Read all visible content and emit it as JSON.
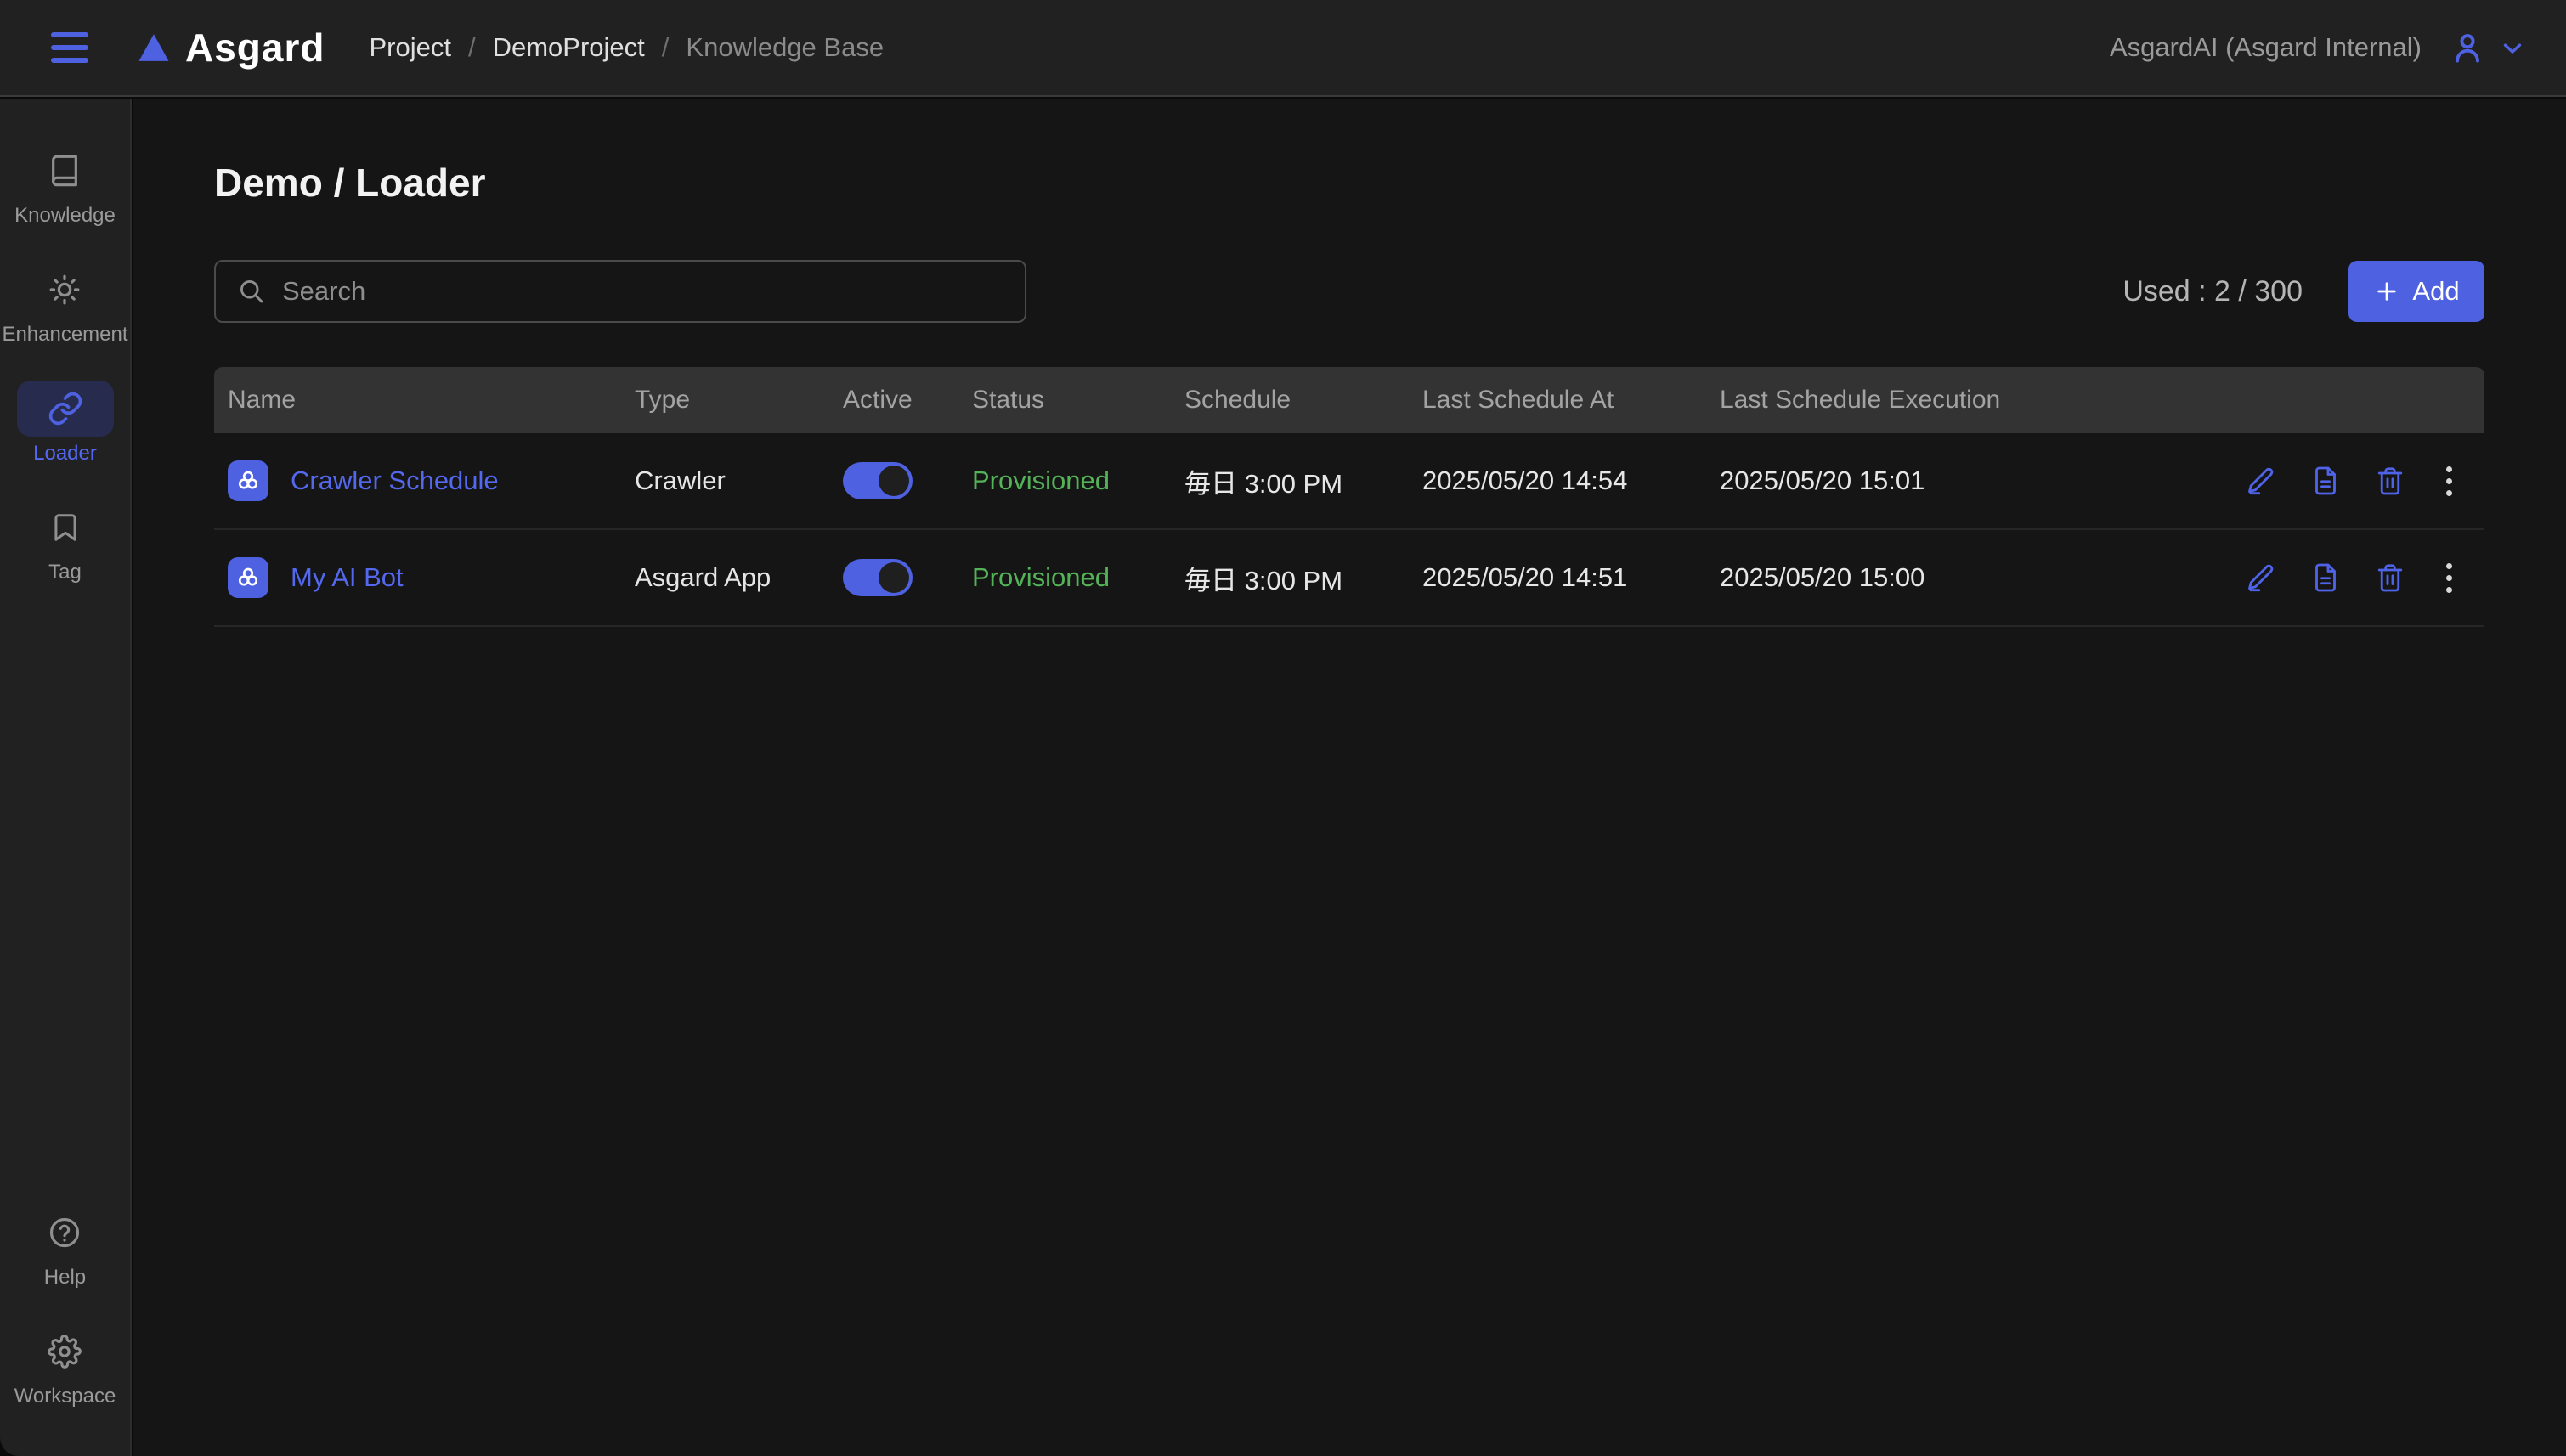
{
  "topbar": {
    "brand": "Asgard",
    "breadcrumb": [
      {
        "label": "Project"
      },
      {
        "label": "DemoProject"
      },
      {
        "label": "Knowledge Base"
      }
    ],
    "breadcrumb_separator": "/",
    "account": "AsgardAI (Asgard Internal)"
  },
  "sidebar": {
    "items": [
      {
        "icon": "book-icon",
        "label": "Knowledge",
        "active": false
      },
      {
        "icon": "sun-icon",
        "label": "Enhancement",
        "active": false
      },
      {
        "icon": "link-icon",
        "label": "Loader",
        "active": true
      },
      {
        "icon": "bookmark-icon",
        "label": "Tag",
        "active": false
      }
    ],
    "footer_items": [
      {
        "icon": "help-circle-icon",
        "label": "Help"
      },
      {
        "icon": "gear-icon",
        "label": "Workspace"
      }
    ]
  },
  "main": {
    "title": "Demo / Loader",
    "search_placeholder": "Search",
    "usage": "Used : 2 / 300",
    "add_button": "Add",
    "table": {
      "columns": [
        "Name",
        "Type",
        "Active",
        "Status",
        "Schedule",
        "Last Schedule At",
        "Last Schedule Execution"
      ],
      "row_actions": [
        "edit",
        "document",
        "delete",
        "more"
      ],
      "rows": [
        {
          "name": "Crawler Schedule",
          "type": "Crawler",
          "active": true,
          "status": "Provisioned",
          "schedule": "毎日 3:00 PM",
          "last_schedule_at": "2025/05/20 14:54",
          "last_schedule_execution": "2025/05/20 15:01"
        },
        {
          "name": "My AI Bot",
          "type": "Asgard App",
          "active": true,
          "status": "Provisioned",
          "schedule": "毎日 3:00 PM",
          "last_schedule_at": "2025/05/20 14:51",
          "last_schedule_execution": "2025/05/20 15:00"
        }
      ]
    }
  },
  "colors": {
    "accent": "#4d61e1",
    "link": "#5468ef",
    "status_provisioned": "#54b358",
    "topbar_bg": "#212121",
    "main_bg": "#151515",
    "table_header_bg": "#333333"
  }
}
